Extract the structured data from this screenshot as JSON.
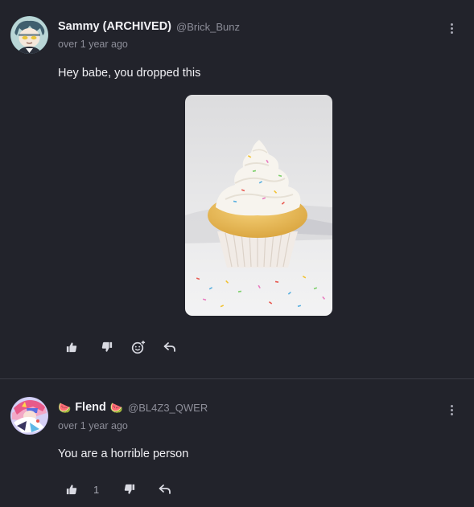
{
  "comments": [
    {
      "display_name": "Sammy (ARCHIVED)",
      "handle": "@Brick_Bunz",
      "timestamp": "over 1 year ago",
      "text": "Hey babe, you dropped this",
      "avatar_icon": "anime-character-avatar",
      "attachment_icon": "cupcake-photo"
    },
    {
      "name_prefix_emoji": "🍉",
      "display_name": "Flend",
      "name_suffix_emoji": "🍉",
      "handle": "@BL4Z3_QWER",
      "timestamp": "over 1 year ago",
      "text": "You are a horrible person",
      "like_count": "1",
      "avatar_icon": "colorful-character-avatar"
    }
  ],
  "icons": {
    "like": "thumbs-up-icon",
    "dislike": "thumbs-down-icon",
    "add_reaction": "add-reaction-icon",
    "reply": "reply-icon",
    "more": "more-options-icon"
  },
  "colors": {
    "background": "#22232b",
    "divider": "#3a3b45",
    "muted_text": "#8d8e99",
    "icon": "#d9dae2"
  }
}
